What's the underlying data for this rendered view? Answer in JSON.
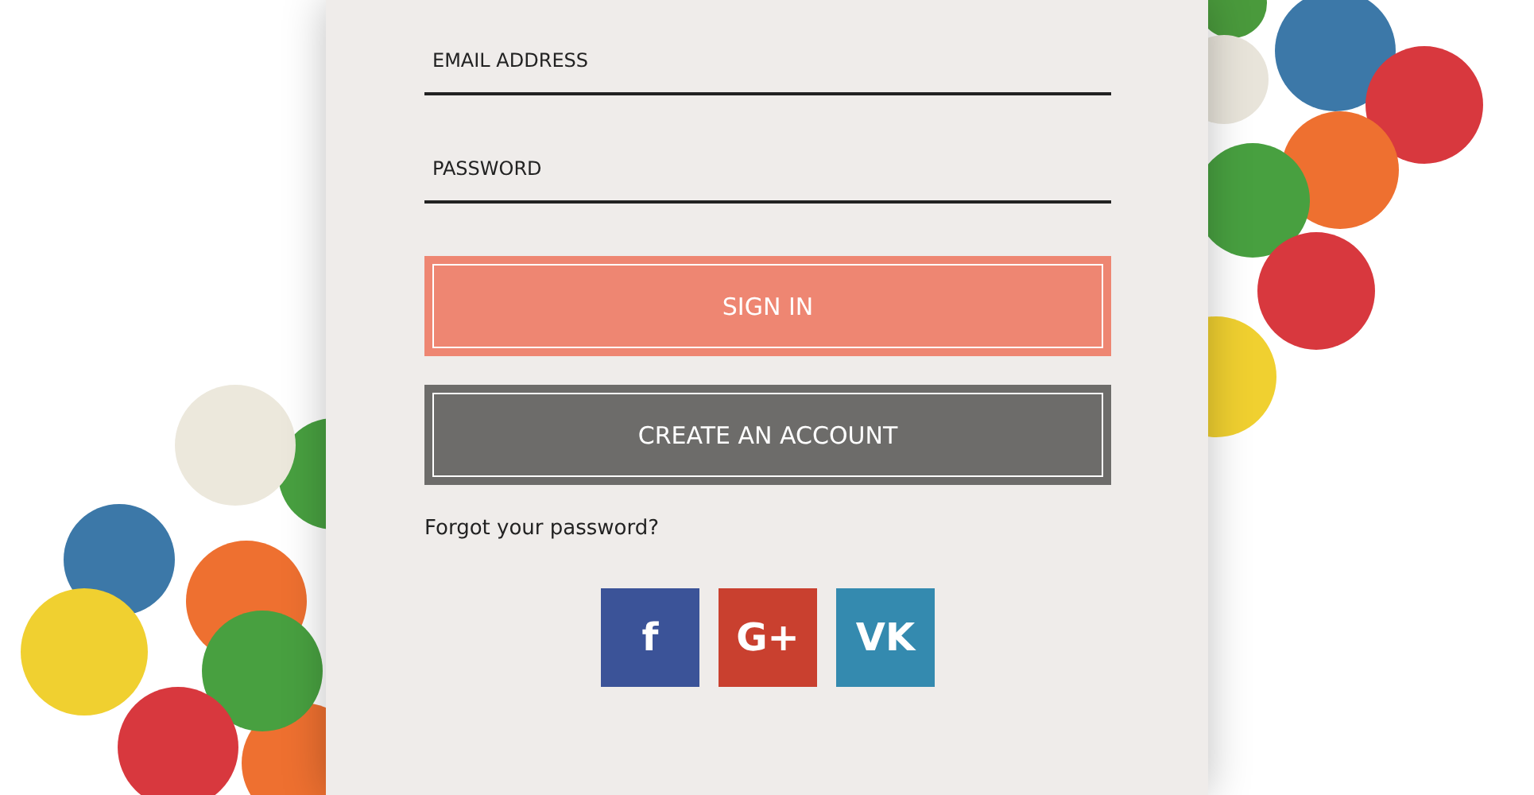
{
  "form": {
    "fields": [
      {
        "placeholder": "EMAIL ADDRESS"
      },
      {
        "placeholder": "PASSWORD"
      }
    ],
    "buttons": [
      {
        "label": "SIGN IN",
        "kind": "primary"
      },
      {
        "label": "CREATE AN ACCOUNT",
        "kind": "secondary"
      }
    ],
    "forgot_link": "Forgot your password?",
    "social": [
      {
        "label": "f",
        "color": "#3b5398"
      },
      {
        "label": "G+",
        "color": "#c9402f"
      },
      {
        "label": "VK",
        "color": "#348aaf"
      }
    ]
  }
}
